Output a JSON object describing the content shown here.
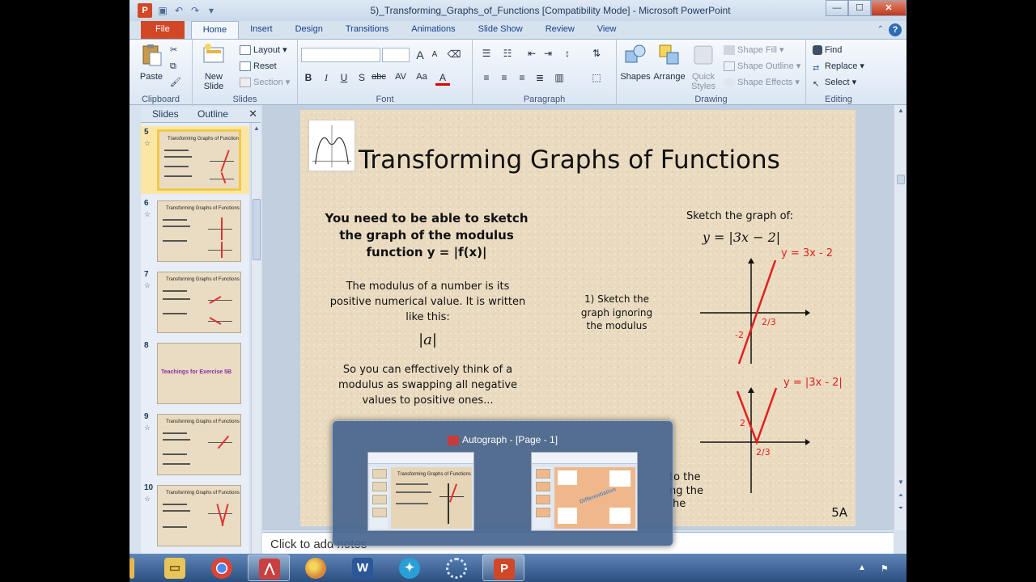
{
  "window": {
    "title": "5)_Transforming_Graphs_of_Functions [Compatibility Mode] - Microsoft PowerPoint",
    "app_icon": "P",
    "minimize": "—",
    "maximize": "☐",
    "close": "✕"
  },
  "tabs": [
    "File",
    "Home",
    "Insert",
    "Design",
    "Transitions",
    "Animations",
    "Slide Show",
    "Review",
    "View"
  ],
  "active_tab": "Home",
  "ribbon": {
    "clipboard": {
      "label": "Clipboard",
      "paste": "Paste"
    },
    "slides": {
      "label": "Slides",
      "new_slide": "New Slide",
      "layout": "Layout ▾",
      "reset": "Reset",
      "section": "Section ▾"
    },
    "font": {
      "label": "Font",
      "bold": "B",
      "italic": "I",
      "underline": "U",
      "shadow": "S",
      "strike": "abc",
      "spacing": "AV",
      "case": "Aa",
      "color": "A",
      "grow": "A",
      "shrink": "A"
    },
    "paragraph": {
      "label": "Paragraph"
    },
    "drawing": {
      "label": "Drawing",
      "shapes": "Shapes",
      "arrange": "Arrange",
      "quick_styles": "Quick Styles",
      "shape_fill": "Shape Fill ▾",
      "shape_outline": "Shape Outline ▾",
      "shape_effects": "Shape Effects ▾"
    },
    "editing": {
      "label": "Editing",
      "find": "Find",
      "replace": "Replace ▾",
      "select": "Select ▾"
    }
  },
  "pane": {
    "tab_slides": "Slides",
    "tab_outline": "Outline",
    "close": "✕",
    "thumbnails": [
      {
        "num": "5",
        "title": "Transforming Graphs of Functions",
        "selected": true
      },
      {
        "num": "6",
        "title": "Transforming Graphs of Functions",
        "selected": false
      },
      {
        "num": "7",
        "title": "Transforming Graphs of Functions",
        "selected": false
      },
      {
        "num": "8",
        "title": "Teachings for Exercise 5B",
        "selected": false
      },
      {
        "num": "9",
        "title": "Transforming Graphs of Functions",
        "selected": false
      },
      {
        "num": "10",
        "title": "Transforming Graphs of Functions",
        "selected": false
      }
    ]
  },
  "slide": {
    "title": "Transforming Graphs of Functions",
    "intro_1": "You need to be able to sketch",
    "intro_2": "the graph of the modulus",
    "intro_3": "function y = |f(x)|",
    "mod_1": "The modulus of a number is its",
    "mod_2": "positive numerical value. It is written",
    "mod_3": "like this:",
    "mod_symbol": "|a|",
    "swap_1": "So you can effectively think of a",
    "swap_2": "modulus as swapping all negative",
    "swap_3": "values to positive ones...",
    "sketch_label": "Sketch the graph of:",
    "equation": "y = |3x − 2|",
    "step1_1": "1) Sketch the",
    "step1_2": "graph ignoring",
    "step1_3": "the modulus",
    "graph1_label": "y = 3x - 2",
    "graph1_root": "2/3",
    "graph1_intercept": "-2",
    "graph2_label": "y = |3x - 2|",
    "graph2_root": "2/3",
    "graph2_intercept": "2",
    "step2_partial_1": "to the",
    "step2_partial_2": "ng the",
    "step2_partial_3": "he",
    "slide_number": "5A"
  },
  "notes_placeholder": "Click to add notes",
  "peek": {
    "title": "Autograph - [Page - 1]",
    "thumb1_title": "Transforming Graphs of Functions",
    "thumb2_title": "Differentiation"
  },
  "taskbar": [
    "explorer",
    "chrome",
    "autograph",
    "paint",
    "word",
    "twitter",
    "network",
    "powerpoint"
  ],
  "colors": {
    "accent": "#d24726",
    "graph_red": "#e02020",
    "slide_bg": "#eadbc0"
  }
}
